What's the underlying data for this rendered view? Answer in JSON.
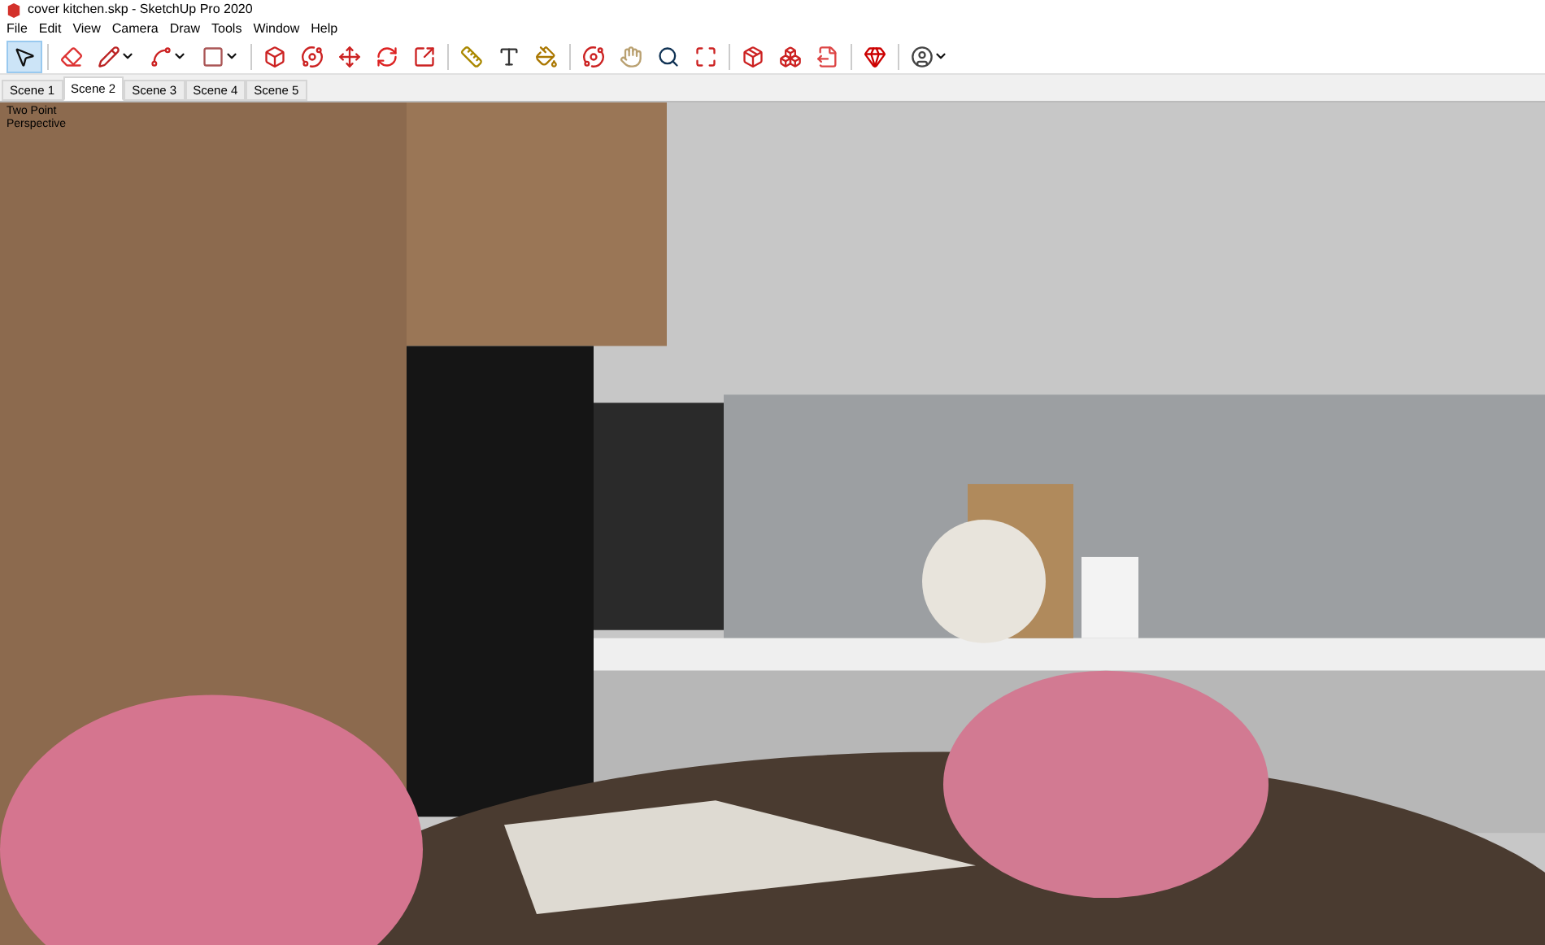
{
  "window": {
    "title": "cover kitchen.skp - SketchUp Pro 2020"
  },
  "menu": [
    "File",
    "Edit",
    "View",
    "Camera",
    "Draw",
    "Tools",
    "Window",
    "Help"
  ],
  "toolbar": {
    "tools": [
      {
        "selected": true,
        "dropdown": false
      },
      {
        "selected": false,
        "dropdown": false
      },
      {
        "selected": false,
        "dropdown": true
      },
      {
        "selected": false,
        "dropdown": true
      },
      {
        "selected": false,
        "dropdown": true
      },
      {
        "selected": false,
        "dropdown": false
      },
      {
        "selected": false,
        "dropdown": false
      },
      {
        "selected": false,
        "dropdown": false
      },
      {
        "selected": false,
        "dropdown": false
      },
      {
        "selected": false,
        "dropdown": false
      },
      {
        "selected": false,
        "dropdown": false
      },
      {
        "selected": false,
        "dropdown": false
      },
      {
        "selected": false,
        "dropdown": false
      },
      {
        "selected": false,
        "dropdown": false
      },
      {
        "selected": false,
        "dropdown": false
      },
      {
        "selected": false,
        "dropdown": false
      },
      {
        "selected": false,
        "dropdown": false
      },
      {
        "selected": false,
        "dropdown": false
      },
      {
        "selected": false,
        "dropdown": false
      },
      {
        "selected": false,
        "dropdown": false
      },
      {
        "selected": false,
        "dropdown": false
      },
      {
        "selected": false,
        "dropdown": true
      }
    ]
  },
  "scenes": [
    {
      "label": "Scene 1",
      "selected": false
    },
    {
      "label": "Scene 2",
      "selected": true
    },
    {
      "label": "Scene 3",
      "selected": false
    },
    {
      "label": "Scene 4",
      "selected": false
    },
    {
      "label": "Scene 5",
      "selected": false
    }
  ],
  "viewport": {
    "camera_label": "Two Point Perspective",
    "kind": "picture"
  }
}
